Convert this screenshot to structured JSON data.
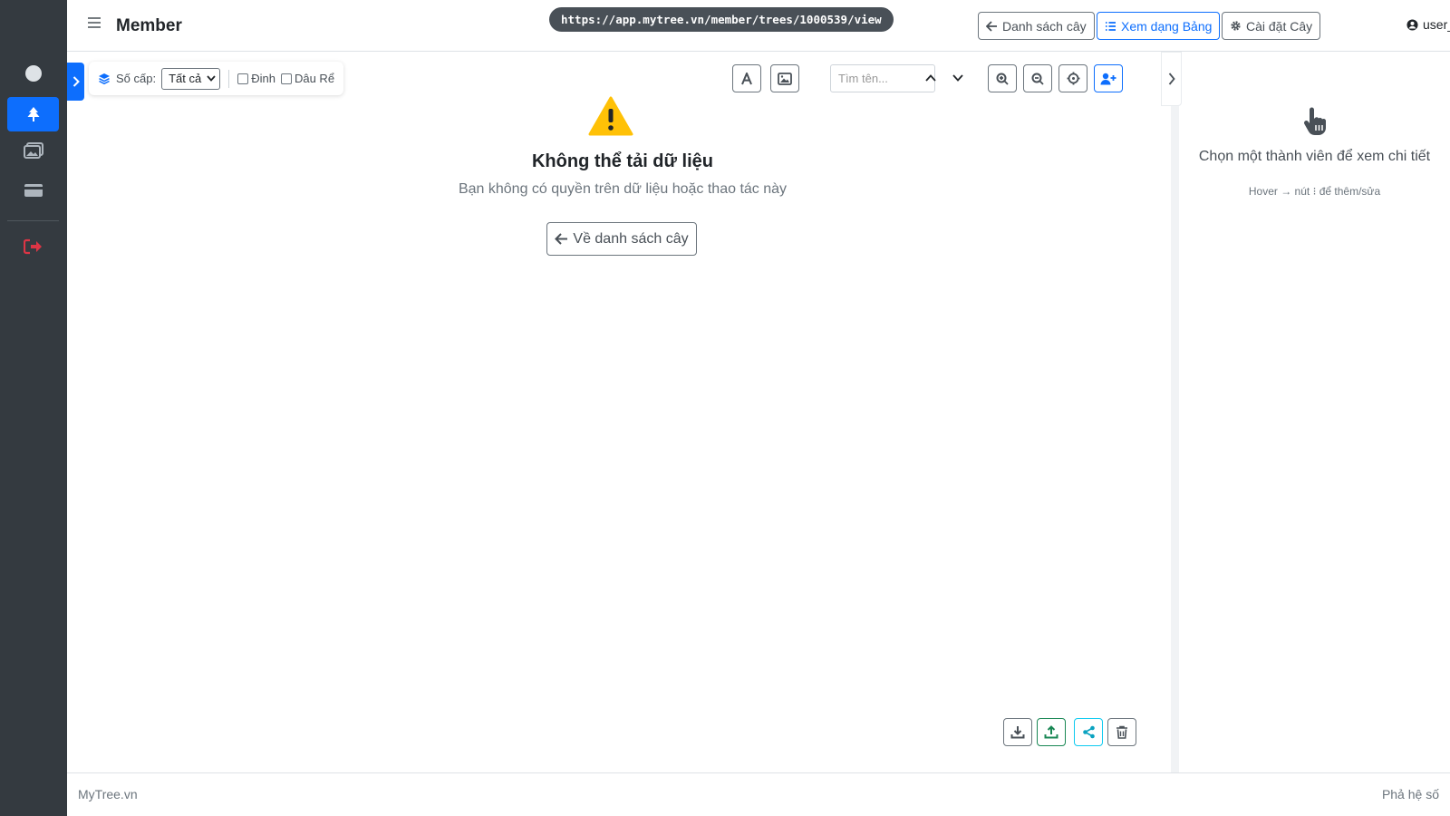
{
  "header": {
    "title": "Member",
    "url": "https://app.mytree.vn/member/trees/1000539/view",
    "buttons": {
      "tree_list": "Danh sách cây",
      "table_view": "Xem dạng Bảng",
      "tree_settings": "Cài đặt Cây"
    },
    "user": "user_b@exa..."
  },
  "sidebar": {
    "items": [
      {
        "icon": "circle-icon",
        "active": false
      },
      {
        "icon": "tree-icon",
        "active": true
      },
      {
        "icon": "images-icon",
        "active": false
      },
      {
        "icon": "card-icon",
        "active": false
      },
      {
        "icon": "logout-icon",
        "active": false
      }
    ]
  },
  "toolbar": {
    "levels_label": "Số cấp:",
    "levels_selected": "Tất cả",
    "check_dinh": "Đinh",
    "check_daure": "Dâu Rể",
    "search_placeholder": "Tìm tên..."
  },
  "error": {
    "title": "Không thể tải dữ liệu",
    "message": "Bạn không có quyền trên dữ liệu hoặc thao tác này",
    "back_button": "Về danh sách cây"
  },
  "panel": {
    "prompt": "Chọn một thành viên để xem chi tiết",
    "hint": "Hover → nút ⁝ để thêm/sửa"
  },
  "footer": {
    "left": "MyTree.vn",
    "right": "Phả hệ số"
  },
  "colors": {
    "sidebar": "#343a40",
    "primary": "#0d6efd",
    "warning": "#ffc107",
    "danger": "#dc3545",
    "success": "#198754",
    "info": "#0dcaf0"
  }
}
